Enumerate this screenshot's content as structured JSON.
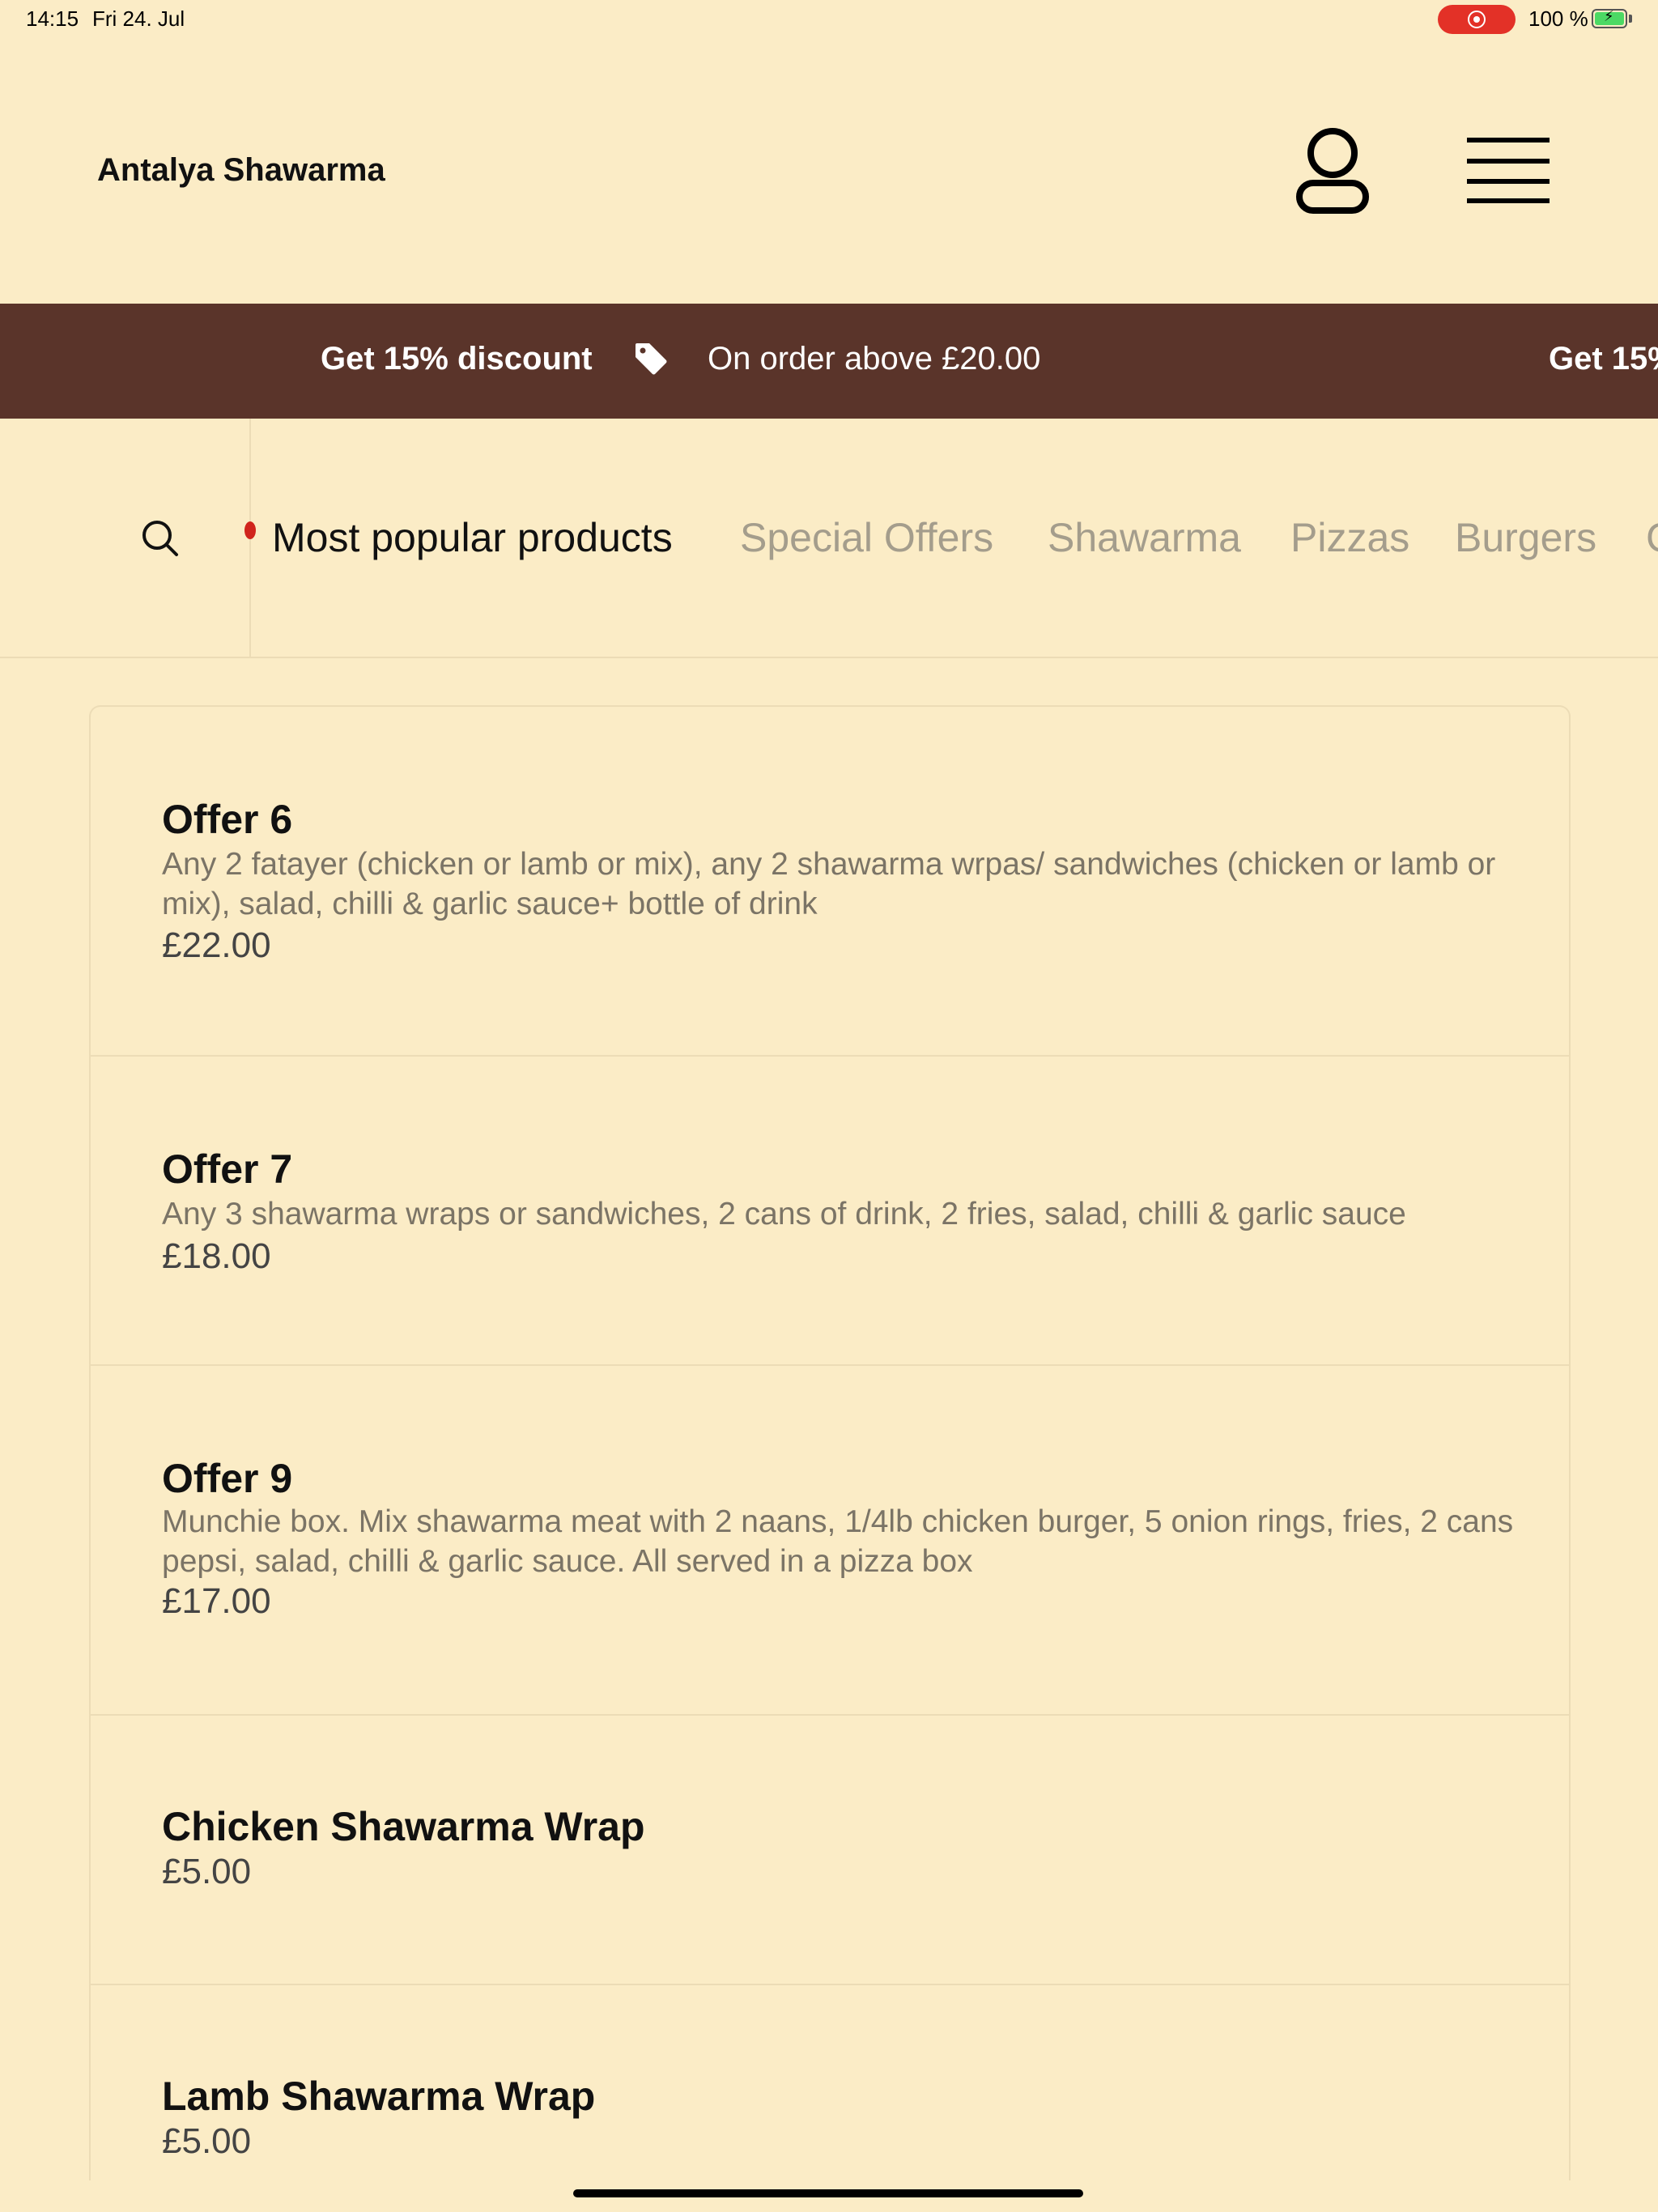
{
  "status_bar": {
    "time": "14:15",
    "date": "Fri 24. Jul",
    "battery": "100 %"
  },
  "header": {
    "brand": "Antalya Shawarma",
    "icons": [
      "user-icon",
      "menu-icon"
    ]
  },
  "promo": {
    "headline": "Get 15% discount",
    "condition": "On order above £20.00",
    "headline_repeat": "Get 15%"
  },
  "categories": {
    "items": [
      "Most popular products",
      "Special Offers",
      "Shawarma",
      "Pizzas",
      "Burgers",
      "C"
    ],
    "active": "Most popular products"
  },
  "products": [
    {
      "name": "Offer 6",
      "description": "Any 2 fatayer (chicken or lamb or mix), any 2 shawarma wrpas/ sandwiches (chicken or lamb or mix), salad, chilli & garlic sauce+ bottle of drink",
      "price": "£22.00"
    },
    {
      "name": "Offer 7",
      "description": "Any 3 shawarma wraps or sandwiches, 2 cans of drink, 2 fries, salad, chilli & garlic sauce",
      "price": "£18.00"
    },
    {
      "name": "Offer 9",
      "description": "Munchie box. Mix shawarma meat with 2 naans, 1/4lb chicken burger, 5 onion rings, fries, 2 cans pepsi, salad, chilli & garlic sauce. All served in a pizza box",
      "price": "£17.00"
    },
    {
      "name": "Chicken Shawarma Wrap",
      "price": "£5.00"
    },
    {
      "name": "Lamb Shawarma Wrap",
      "price": "£5.00"
    }
  ],
  "colors": {
    "background": "#fbecc6",
    "banner": "#5a342a",
    "recording": "#e33127",
    "inactive_tab": "#a49d8c"
  }
}
